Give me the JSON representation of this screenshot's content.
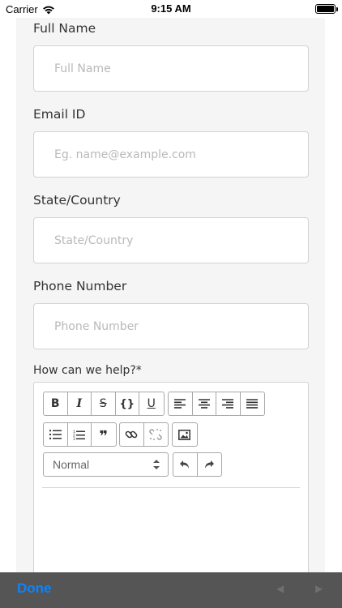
{
  "status_bar": {
    "carrier": "Carrier",
    "time": "9:15 AM"
  },
  "form": {
    "full_name": {
      "label": "Full Name",
      "placeholder": "Full Name",
      "value": ""
    },
    "email": {
      "label": "Email ID",
      "placeholder": "Eg. name@example.com",
      "value": ""
    },
    "state": {
      "label": "State/Country",
      "placeholder": "State/Country",
      "value": ""
    },
    "phone": {
      "label": "Phone Number",
      "placeholder": "Phone Number",
      "value": ""
    },
    "help_label": "How can we help?*"
  },
  "editor": {
    "text_style": "Normal",
    "buttons": [
      "bold",
      "italic",
      "strikethrough",
      "code",
      "underline",
      "align-left",
      "align-center",
      "align-right",
      "align-justify",
      "bulleted-list",
      "numbered-list",
      "blockquote",
      "link",
      "unlink",
      "image",
      "undo",
      "redo"
    ]
  },
  "accessory_bar": {
    "done_label": "Done",
    "prev_arrow": "◀",
    "next_arrow": "▶"
  },
  "colors": {
    "accent": "#0a84ff",
    "panel_bg": "#f5f5f5",
    "bar_bg": "#555555"
  }
}
